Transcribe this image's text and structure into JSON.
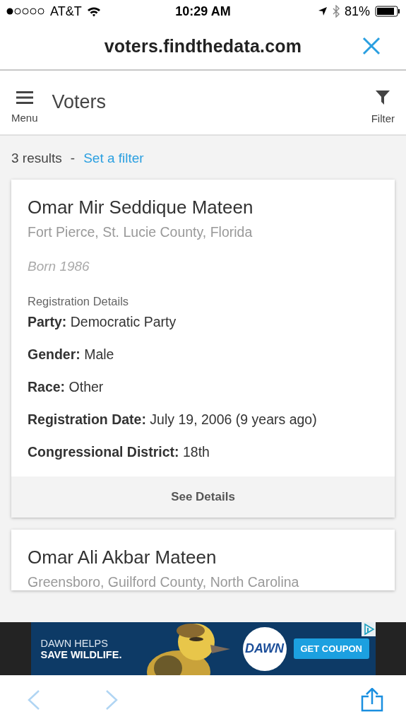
{
  "status_bar": {
    "carrier": "AT&T",
    "time": "10:29 AM",
    "battery": "81%"
  },
  "browser_bar": {
    "url": "voters.findthedata.com"
  },
  "header": {
    "menu_label": "Menu",
    "title": "Voters",
    "filter_label": "Filter"
  },
  "results": {
    "count": "3 results",
    "separator": "-",
    "link": "Set a filter"
  },
  "cards": [
    {
      "name": "Omar Mir Seddique Mateen",
      "location": "Fort Pierce, St. Lucie County, Florida",
      "born": "Born 1986",
      "section": "Registration Details",
      "fields": [
        {
          "label": "Party:",
          "value": "Democratic Party"
        },
        {
          "label": "Gender:",
          "value": "Male"
        },
        {
          "label": "Race:",
          "value": "Other"
        },
        {
          "label": "Registration Date:",
          "value": "July 19, 2006 (9 years ago)"
        },
        {
          "label": "Congressional District:",
          "value": "18th"
        }
      ],
      "action": "See Details"
    },
    {
      "name": "Omar Ali Akbar Mateen",
      "location": "Greensboro, Guilford County, North Carolina"
    }
  ],
  "ad": {
    "headline_1": "DAWN HELPS",
    "headline_2": "SAVE WILDLIFE.",
    "brand": "DAWN",
    "button": "GET COUPON"
  },
  "toolbar": {
    "back_disabled": true,
    "forward_disabled": true
  }
}
